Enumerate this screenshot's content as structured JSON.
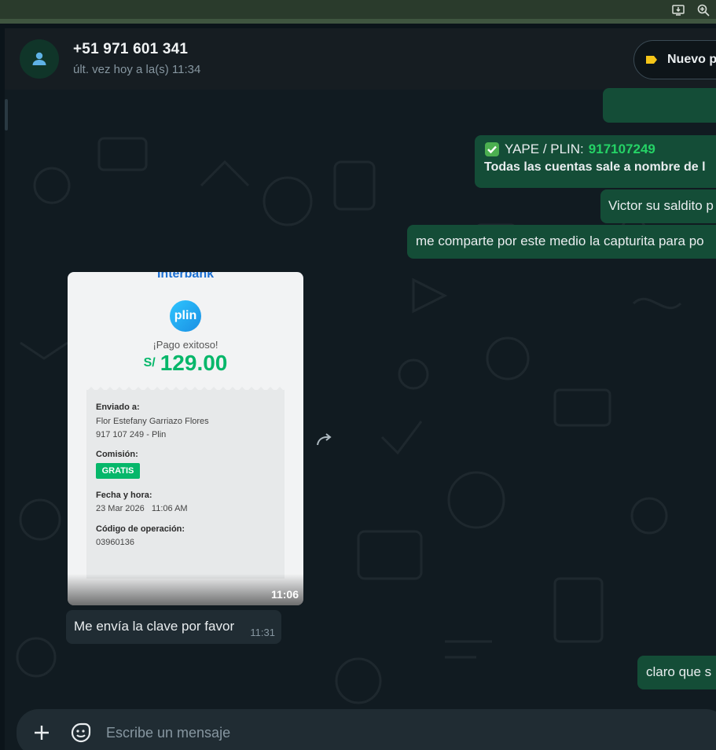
{
  "window": {
    "icons": [
      "download-screen-icon",
      "zoom-icon"
    ]
  },
  "header": {
    "contact_name": "+51 971 601 341",
    "status": "últ. vez hoy a la(s) 11:34",
    "new_button_label": "Nuevo p"
  },
  "messages": {
    "out_yape_prefix": "YAPE / PLIN: ",
    "out_yape_number": "917107249",
    "out_yape_line2": "Todas las cuentas sale a nombre de l",
    "out_victor": "Victor su saldito p",
    "out_capture": "me comparte por este medio la capturita para po",
    "out_claro": "claro que s",
    "in_clave": "Me envía la clave por favor",
    "in_clave_time": "11:31"
  },
  "receipt": {
    "brand": "Interbank",
    "logo_text": "plin",
    "status": "¡Pago exitoso!",
    "currency": "S/",
    "amount": "129.00",
    "sent_to_label": "Enviado a:",
    "recipient_name": "Flor Estefany Garriazo Flores",
    "recipient_phone": "917 107 249 - Plin",
    "commission_label": "Comisión:",
    "commission_value": "GRATIS",
    "datetime_label": "Fecha y hora:",
    "datetime_value": "23 Mar 2026   11:06 AM",
    "operation_label": "Código de operación:",
    "operation_value": "03960136",
    "time": "11:06"
  },
  "composer": {
    "placeholder": "Escribe un mensaje"
  },
  "colors": {
    "background": "#111b21",
    "outgoing_bubble": "#144d37",
    "incoming_bubble": "#202c33",
    "accent_green": "#25d366",
    "plin_green": "#06b76a"
  }
}
